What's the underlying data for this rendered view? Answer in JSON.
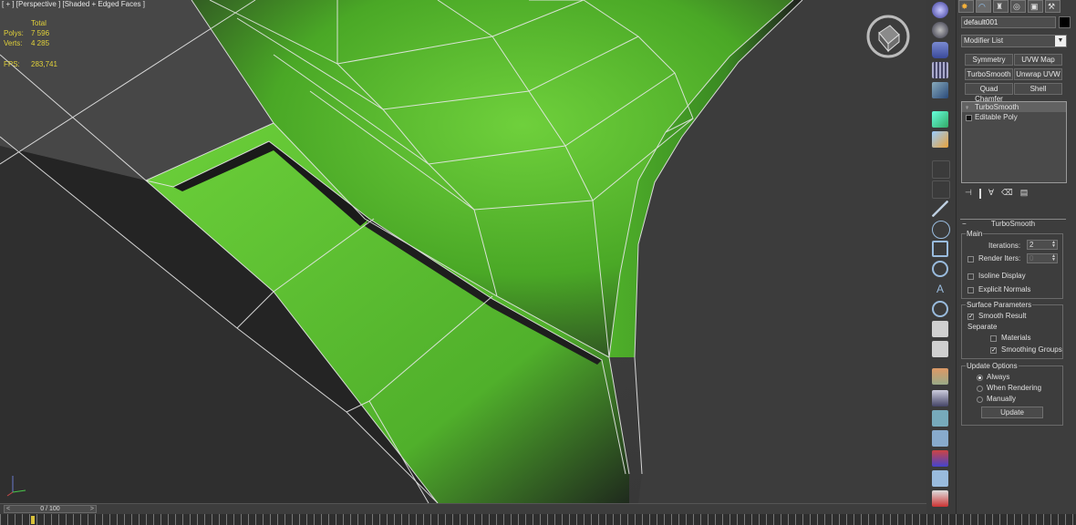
{
  "viewport": {
    "label": "[ + ] [Perspective ] [Shaded + Edged Faces ]",
    "stats": {
      "header": "Total",
      "polys_label": "Polys:",
      "polys_value": "7 596",
      "verts_label": "Verts:",
      "verts_value": "4 285",
      "fps_label": "FPS:",
      "fps_value": "283,741"
    }
  },
  "timeline": {
    "range": "0 / 100",
    "prev": "<",
    "next": ">"
  },
  "command_panel": {
    "object_name": "default001",
    "modifier_list": "Modifier List",
    "modifier_buttons": [
      "Symmetry",
      "UVW Map",
      "TurboSmooth",
      "Unwrap UVW",
      "Quad Chamfer",
      "Shell"
    ],
    "stack": [
      "TurboSmooth",
      "Editable Poly"
    ],
    "rollout": {
      "title": "TurboSmooth",
      "main": {
        "title": "Main",
        "iterations_label": "Iterations:",
        "iterations_value": "2",
        "render_iters_label": "Render Iters:",
        "render_iters_value": "0",
        "isoline_label": "Isoline Display",
        "explicit_normals_label": "Explicit Normals"
      },
      "surface": {
        "title": "Surface Parameters",
        "smooth_result_label": "Smooth Result",
        "separate_label": "Separate",
        "materials_label": "Materials",
        "smoothing_groups_label": "Smoothing Groups"
      },
      "update": {
        "title": "Update Options",
        "options": [
          "Always",
          "When Rendering",
          "Manually"
        ],
        "button": "Update"
      }
    }
  },
  "colors": {
    "mesh_green": "#5ec232",
    "stats_yellow": "#e2d23a",
    "frame_yellow": "#c8b33a"
  }
}
